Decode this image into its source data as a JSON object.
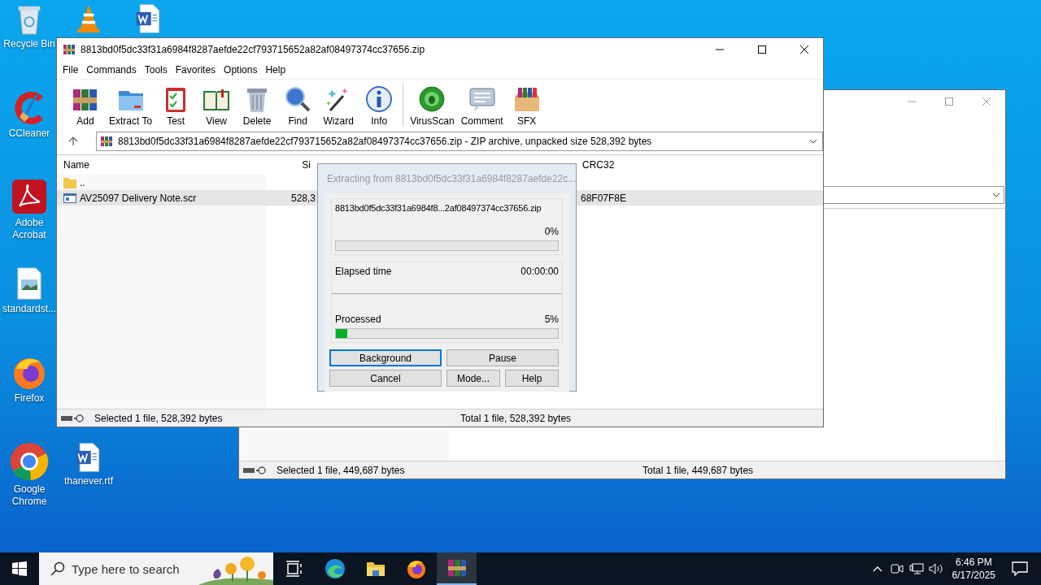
{
  "desktop_icons": [
    {
      "kind": "recycle",
      "label": "Recycle Bin"
    },
    {
      "kind": "vlc"
    },
    {
      "kind": "word"
    },
    {
      "kind": "ccleaner",
      "label": "CCleaner"
    },
    {
      "kind": "acrobat",
      "label": "Adobe Acrobat"
    },
    {
      "kind": "image",
      "label": "standardst..."
    },
    {
      "kind": "firefox",
      "label": "Firefox"
    },
    {
      "kind": "chrome",
      "label": "Google Chrome"
    },
    {
      "kind": "word",
      "label": "thanever.rtf"
    }
  ],
  "back_window": {
    "status_left": "Selected 1 file, 449,687 bytes",
    "status_right": "Total 1 file, 449,687 bytes"
  },
  "main_window": {
    "title": "8813bd0f5dc33f31a6984f8287aefde22cf793715652a82af08497374cc37656.zip",
    "menu": [
      "File",
      "Commands",
      "Tools",
      "Favorites",
      "Options",
      "Help"
    ],
    "toolbar": [
      {
        "kind": "add",
        "label": "Add"
      },
      {
        "kind": "extract",
        "label": "Extract To"
      },
      {
        "kind": "test",
        "label": "Test"
      },
      {
        "kind": "view",
        "label": "View"
      },
      {
        "kind": "delete",
        "label": "Delete"
      },
      {
        "kind": "find",
        "label": "Find"
      },
      {
        "kind": "wizard",
        "label": "Wizard"
      },
      {
        "kind": "info",
        "label": "Info"
      },
      {
        "kind": "virus",
        "label": "VirusScan"
      },
      {
        "kind": "comment",
        "label": "Comment"
      },
      {
        "kind": "sfx",
        "label": "SFX"
      }
    ],
    "address": "8813bd0f5dc33f31a6984f8287aefde22cf793715652a82af08497374cc37656.zip - ZIP archive, unpacked size 528,392 bytes",
    "columns": [
      "Name",
      "Si",
      "CRC32"
    ],
    "rows": [
      {
        "kind": "folder",
        "name": "..",
        "selected": false
      },
      {
        "kind": "file",
        "name": "AV25097 Delivery Note.scr",
        "size": "528,3",
        "crc": "68F07F8E",
        "selected": true
      }
    ],
    "status_left": "Selected 1 file, 528,392 bytes",
    "status_right": "Total 1 file, 528,392 bytes"
  },
  "dialog": {
    "title": "Extracting from 8813bd0f5dc33f31a6984f8287aefde22c...",
    "archive": "8813bd0f5dc33f31a6984f8...2af08497374cc37656.zip",
    "file_percent": "0%",
    "file_progress": {
      "level": 0
    },
    "elapsed_label": "Elapsed time",
    "elapsed": "00:00:00",
    "processed_label": "Processed",
    "processed_percent": "5%",
    "processed_progress": {
      "level": 0.05
    },
    "buttons": [
      {
        "label": "Background",
        "focused": true
      },
      {
        "label": "Pause",
        "focused": false
      },
      {
        "label": "Cancel",
        "focused": false
      },
      {
        "label": "Mode...",
        "focused": false
      },
      {
        "label": "Help",
        "focused": false
      }
    ]
  },
  "taskbar": {
    "search_placeholder": "Type here to search",
    "apps": [
      {
        "kind": "taskview",
        "selected": false
      },
      {
        "kind": "edge",
        "selected": false
      },
      {
        "kind": "folder",
        "selected": false
      },
      {
        "kind": "firefox",
        "selected": false
      },
      {
        "kind": "winrar",
        "selected": true
      }
    ],
    "time": "6:46 PM",
    "date": "6/17/2025"
  }
}
